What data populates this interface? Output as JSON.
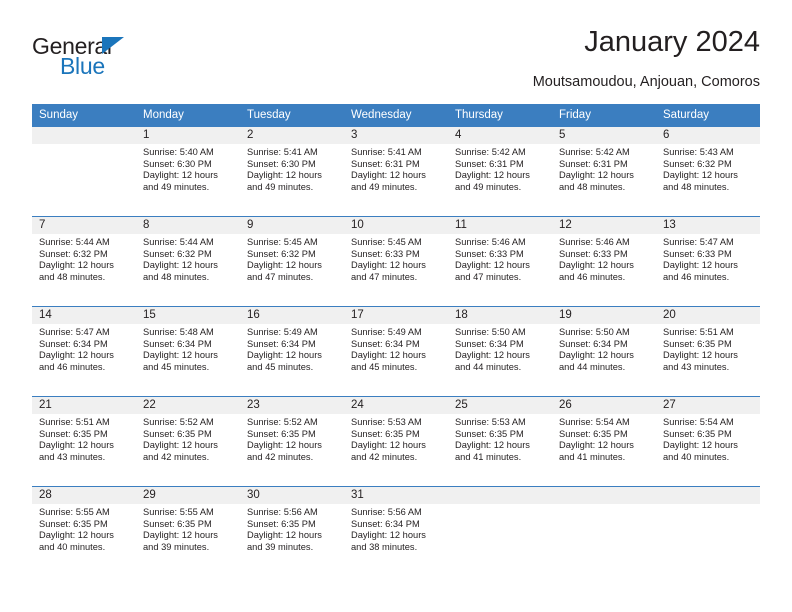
{
  "brand": {
    "line1": "General",
    "line2": "Blue",
    "accent_color": "#1b75bb"
  },
  "header": {
    "title": "January 2024",
    "subtitle": "Moutsamoudou, Anjouan, Comoros"
  },
  "theme": {
    "header_blue": "#3b7ec0",
    "daynum_band": "#f0f0f0",
    "text": "#231f20"
  },
  "weekday_headers": [
    "Sunday",
    "Monday",
    "Tuesday",
    "Wednesday",
    "Thursday",
    "Friday",
    "Saturday"
  ],
  "weeks": [
    [
      {
        "day": "",
        "empty": true
      },
      {
        "day": "1",
        "sunrise": "Sunrise: 5:40 AM",
        "sunset": "Sunset: 6:30 PM",
        "daylight1": "Daylight: 12 hours",
        "daylight2": "and 49 minutes."
      },
      {
        "day": "2",
        "sunrise": "Sunrise: 5:41 AM",
        "sunset": "Sunset: 6:30 PM",
        "daylight1": "Daylight: 12 hours",
        "daylight2": "and 49 minutes."
      },
      {
        "day": "3",
        "sunrise": "Sunrise: 5:41 AM",
        "sunset": "Sunset: 6:31 PM",
        "daylight1": "Daylight: 12 hours",
        "daylight2": "and 49 minutes."
      },
      {
        "day": "4",
        "sunrise": "Sunrise: 5:42 AM",
        "sunset": "Sunset: 6:31 PM",
        "daylight1": "Daylight: 12 hours",
        "daylight2": "and 49 minutes."
      },
      {
        "day": "5",
        "sunrise": "Sunrise: 5:42 AM",
        "sunset": "Sunset: 6:31 PM",
        "daylight1": "Daylight: 12 hours",
        "daylight2": "and 48 minutes."
      },
      {
        "day": "6",
        "sunrise": "Sunrise: 5:43 AM",
        "sunset": "Sunset: 6:32 PM",
        "daylight1": "Daylight: 12 hours",
        "daylight2": "and 48 minutes."
      }
    ],
    [
      {
        "day": "7",
        "sunrise": "Sunrise: 5:44 AM",
        "sunset": "Sunset: 6:32 PM",
        "daylight1": "Daylight: 12 hours",
        "daylight2": "and 48 minutes."
      },
      {
        "day": "8",
        "sunrise": "Sunrise: 5:44 AM",
        "sunset": "Sunset: 6:32 PM",
        "daylight1": "Daylight: 12 hours",
        "daylight2": "and 48 minutes."
      },
      {
        "day": "9",
        "sunrise": "Sunrise: 5:45 AM",
        "sunset": "Sunset: 6:32 PM",
        "daylight1": "Daylight: 12 hours",
        "daylight2": "and 47 minutes."
      },
      {
        "day": "10",
        "sunrise": "Sunrise: 5:45 AM",
        "sunset": "Sunset: 6:33 PM",
        "daylight1": "Daylight: 12 hours",
        "daylight2": "and 47 minutes."
      },
      {
        "day": "11",
        "sunrise": "Sunrise: 5:46 AM",
        "sunset": "Sunset: 6:33 PM",
        "daylight1": "Daylight: 12 hours",
        "daylight2": "and 47 minutes."
      },
      {
        "day": "12",
        "sunrise": "Sunrise: 5:46 AM",
        "sunset": "Sunset: 6:33 PM",
        "daylight1": "Daylight: 12 hours",
        "daylight2": "and 46 minutes."
      },
      {
        "day": "13",
        "sunrise": "Sunrise: 5:47 AM",
        "sunset": "Sunset: 6:33 PM",
        "daylight1": "Daylight: 12 hours",
        "daylight2": "and 46 minutes."
      }
    ],
    [
      {
        "day": "14",
        "sunrise": "Sunrise: 5:47 AM",
        "sunset": "Sunset: 6:34 PM",
        "daylight1": "Daylight: 12 hours",
        "daylight2": "and 46 minutes."
      },
      {
        "day": "15",
        "sunrise": "Sunrise: 5:48 AM",
        "sunset": "Sunset: 6:34 PM",
        "daylight1": "Daylight: 12 hours",
        "daylight2": "and 45 minutes."
      },
      {
        "day": "16",
        "sunrise": "Sunrise: 5:49 AM",
        "sunset": "Sunset: 6:34 PM",
        "daylight1": "Daylight: 12 hours",
        "daylight2": "and 45 minutes."
      },
      {
        "day": "17",
        "sunrise": "Sunrise: 5:49 AM",
        "sunset": "Sunset: 6:34 PM",
        "daylight1": "Daylight: 12 hours",
        "daylight2": "and 45 minutes."
      },
      {
        "day": "18",
        "sunrise": "Sunrise: 5:50 AM",
        "sunset": "Sunset: 6:34 PM",
        "daylight1": "Daylight: 12 hours",
        "daylight2": "and 44 minutes."
      },
      {
        "day": "19",
        "sunrise": "Sunrise: 5:50 AM",
        "sunset": "Sunset: 6:34 PM",
        "daylight1": "Daylight: 12 hours",
        "daylight2": "and 44 minutes."
      },
      {
        "day": "20",
        "sunrise": "Sunrise: 5:51 AM",
        "sunset": "Sunset: 6:35 PM",
        "daylight1": "Daylight: 12 hours",
        "daylight2": "and 43 minutes."
      }
    ],
    [
      {
        "day": "21",
        "sunrise": "Sunrise: 5:51 AM",
        "sunset": "Sunset: 6:35 PM",
        "daylight1": "Daylight: 12 hours",
        "daylight2": "and 43 minutes."
      },
      {
        "day": "22",
        "sunrise": "Sunrise: 5:52 AM",
        "sunset": "Sunset: 6:35 PM",
        "daylight1": "Daylight: 12 hours",
        "daylight2": "and 42 minutes."
      },
      {
        "day": "23",
        "sunrise": "Sunrise: 5:52 AM",
        "sunset": "Sunset: 6:35 PM",
        "daylight1": "Daylight: 12 hours",
        "daylight2": "and 42 minutes."
      },
      {
        "day": "24",
        "sunrise": "Sunrise: 5:53 AM",
        "sunset": "Sunset: 6:35 PM",
        "daylight1": "Daylight: 12 hours",
        "daylight2": "and 42 minutes."
      },
      {
        "day": "25",
        "sunrise": "Sunrise: 5:53 AM",
        "sunset": "Sunset: 6:35 PM",
        "daylight1": "Daylight: 12 hours",
        "daylight2": "and 41 minutes."
      },
      {
        "day": "26",
        "sunrise": "Sunrise: 5:54 AM",
        "sunset": "Sunset: 6:35 PM",
        "daylight1": "Daylight: 12 hours",
        "daylight2": "and 41 minutes."
      },
      {
        "day": "27",
        "sunrise": "Sunrise: 5:54 AM",
        "sunset": "Sunset: 6:35 PM",
        "daylight1": "Daylight: 12 hours",
        "daylight2": "and 40 minutes."
      }
    ],
    [
      {
        "day": "28",
        "sunrise": "Sunrise: 5:55 AM",
        "sunset": "Sunset: 6:35 PM",
        "daylight1": "Daylight: 12 hours",
        "daylight2": "and 40 minutes."
      },
      {
        "day": "29",
        "sunrise": "Sunrise: 5:55 AM",
        "sunset": "Sunset: 6:35 PM",
        "daylight1": "Daylight: 12 hours",
        "daylight2": "and 39 minutes."
      },
      {
        "day": "30",
        "sunrise": "Sunrise: 5:56 AM",
        "sunset": "Sunset: 6:35 PM",
        "daylight1": "Daylight: 12 hours",
        "daylight2": "and 39 minutes."
      },
      {
        "day": "31",
        "sunrise": "Sunrise: 5:56 AM",
        "sunset": "Sunset: 6:34 PM",
        "daylight1": "Daylight: 12 hours",
        "daylight2": "and 38 minutes."
      },
      {
        "day": "",
        "empty": true
      },
      {
        "day": "",
        "empty": true
      },
      {
        "day": "",
        "empty": true
      }
    ]
  ]
}
